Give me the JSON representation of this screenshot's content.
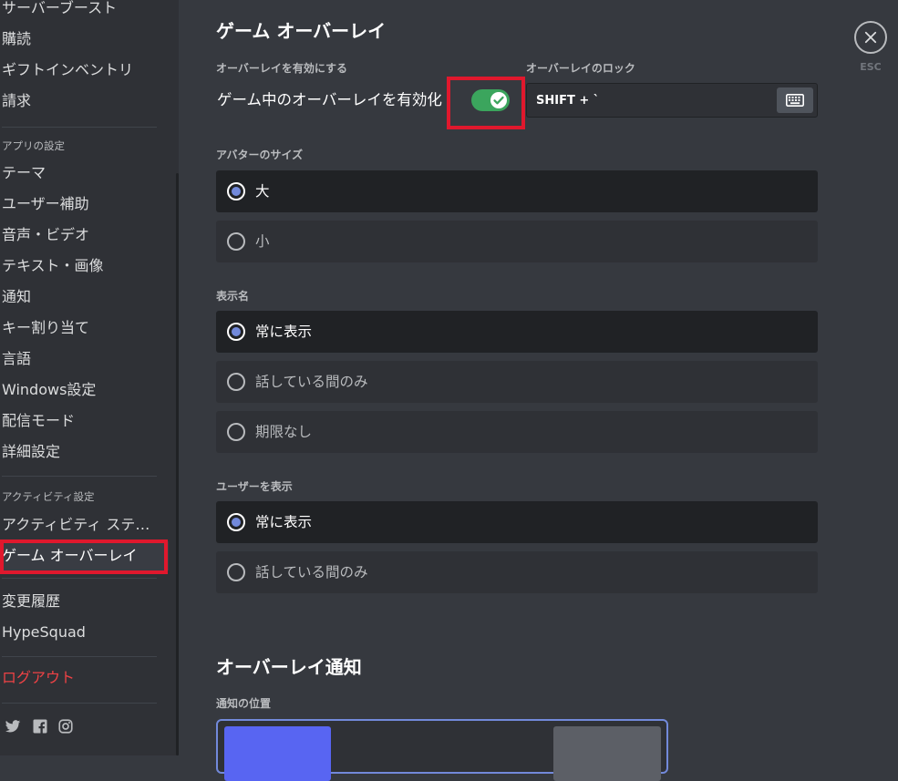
{
  "sidebar": {
    "items_top": [
      "サーバーブースト",
      "購読",
      "ギフトインベントリ",
      "請求"
    ],
    "app_settings_header": "アプリの設定",
    "app_settings_items": [
      "テーマ",
      "ユーザー補助",
      "音声・ビデオ",
      "テキスト・画像",
      "通知",
      "キー割り当て",
      "言語",
      "Windows設定",
      "配信モード",
      "詳細設定"
    ],
    "activity_header": "アクティビティ設定",
    "activity_items": [
      "アクティビティ ステータス",
      "ゲーム オーバーレイ"
    ],
    "other_items": [
      "変更履歴",
      "HypeSquad"
    ],
    "logout": "ログアウト",
    "social_icons": [
      "twitter-icon",
      "facebook-icon",
      "instagram-icon"
    ]
  },
  "main": {
    "title": "ゲーム オーバーレイ",
    "enable_label": "オーバーレイを有効にする",
    "enable_text": "ゲーム中のオーバーレイを有効化",
    "toggle_on": true,
    "lock_label": "オーバーレイのロック",
    "lock_value": "SHIFT + `",
    "avatar_size": {
      "label": "アバターのサイズ",
      "options": [
        "大",
        "小"
      ],
      "selected": 0
    },
    "display_names": {
      "label": "表示名",
      "options": [
        "常に表示",
        "話している間のみ",
        "期限なし"
      ],
      "selected": 0
    },
    "display_users": {
      "label": "ユーザーを表示",
      "options": [
        "常に表示",
        "話している間のみ"
      ],
      "selected": 0
    },
    "notifications_title": "オーバーレイ通知",
    "notification_position_label": "通知の位置"
  },
  "close": {
    "esc": "ESC"
  },
  "colors": {
    "accent": "#7289da",
    "toggle_on": "#3ba55d",
    "highlight": "#e0182d",
    "logout": "#ed4245"
  }
}
